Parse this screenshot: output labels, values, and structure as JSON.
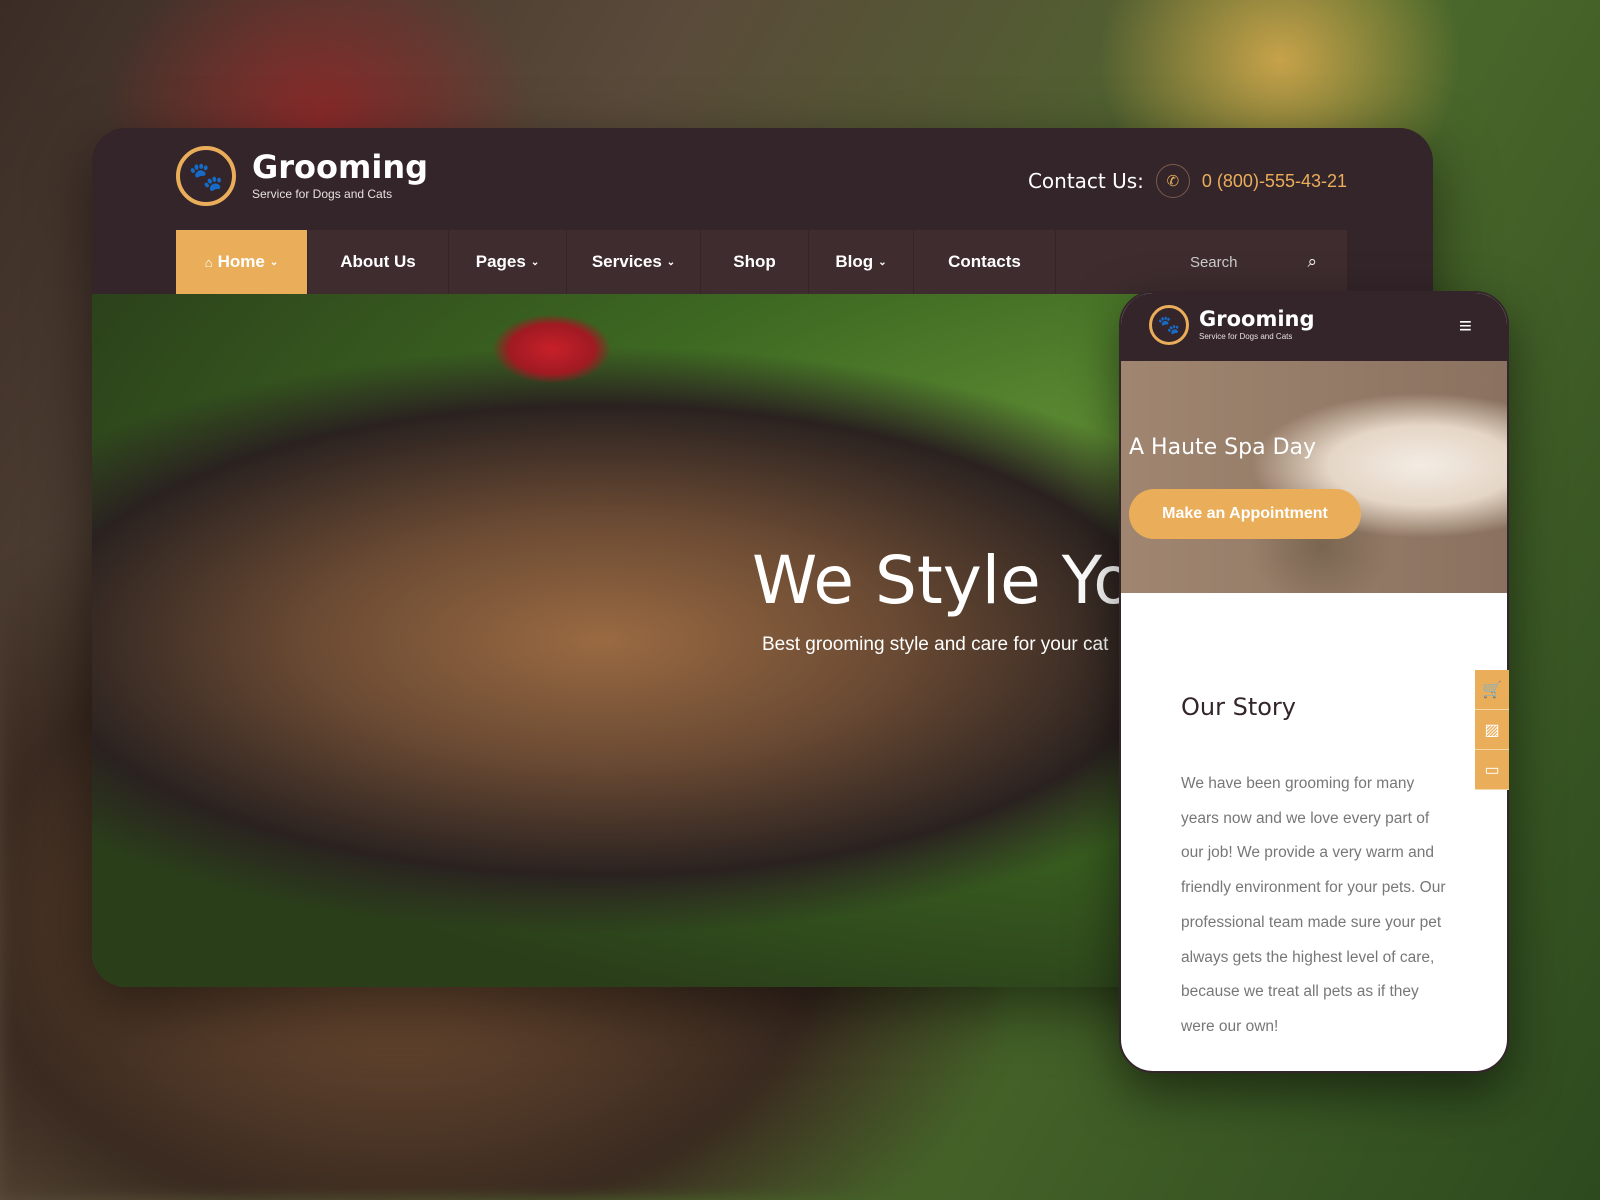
{
  "desktop": {
    "brand": "Grooming",
    "tagline": "Service for Dogs and Cats",
    "contact_label": "Contact Us:",
    "phone": "0 (800)-555-43-21",
    "nav": [
      {
        "label": "Home",
        "dropdown": true,
        "active": true
      },
      {
        "label": "About Us"
      },
      {
        "label": "Pages",
        "dropdown": true
      },
      {
        "label": "Services",
        "dropdown": true
      },
      {
        "label": "Shop"
      },
      {
        "label": "Blog",
        "dropdown": true
      },
      {
        "label": "Contacts"
      }
    ],
    "search_placeholder": "Search",
    "hero_title": "We Style Yo",
    "hero_subtitle": "Best grooming style and care for your cat"
  },
  "mobile": {
    "brand": "Grooming",
    "tagline": "Service for Dogs and Cats",
    "hero_title": "A Haute Spa Day",
    "cta": "Make an Appointment",
    "story_title": "Our Story",
    "story_text": "We have been grooming for many years now and we love every part of our job! We provide a very warm and friendly environment for your pets. Our professional team made sure your pet always gets the highest level of care, because we treat all pets as if they were our own!"
  },
  "side_icons": [
    "cart-icon",
    "gallery-icon",
    "window-icon"
  ],
  "colors": {
    "accent": "#eaae5a",
    "header": "#33252a",
    "nav": "#3e2c2e"
  }
}
